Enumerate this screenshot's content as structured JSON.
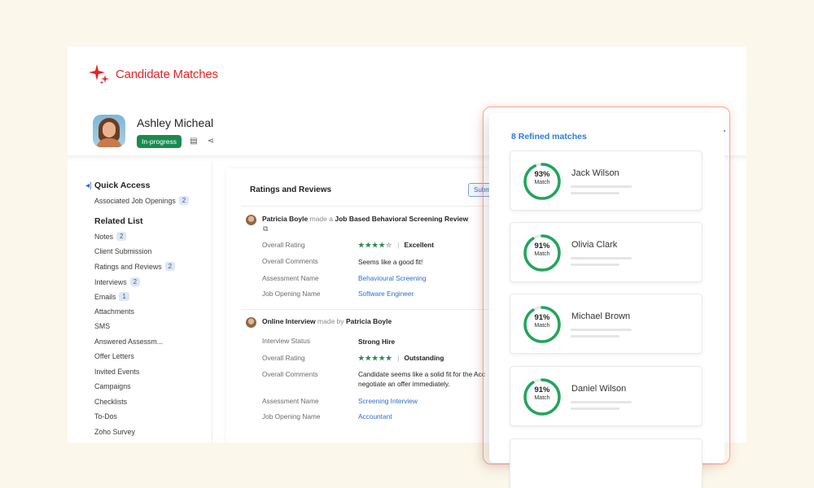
{
  "brand": {
    "title": "Candidate Matches",
    "color": "#e42527"
  },
  "profile": {
    "name": "Ashley Micheal",
    "status": "In-progress",
    "status_color": "#1a8a4f",
    "icons": [
      "notes-icon",
      "share-icon"
    ]
  },
  "sidebar": {
    "quick_access": {
      "heading": "Quick Access",
      "items": [
        {
          "label": "Associated Job Openings",
          "count": "2"
        }
      ]
    },
    "related_list": {
      "heading": "Related List",
      "items": [
        {
          "label": "Notes",
          "count": "2"
        },
        {
          "label": "Client Submission",
          "count": ""
        },
        {
          "label": "Ratings and Reviews",
          "count": "2"
        },
        {
          "label": "Interviews",
          "count": "2"
        },
        {
          "label": "Emails",
          "count": "1"
        },
        {
          "label": "Attachments",
          "count": ""
        },
        {
          "label": "SMS",
          "count": ""
        },
        {
          "label": "Answered Assessm...",
          "count": ""
        },
        {
          "label": "Offer Letters",
          "count": ""
        },
        {
          "label": "Invited Events",
          "count": ""
        },
        {
          "label": "Campaigns",
          "count": ""
        },
        {
          "label": "Checklists",
          "count": ""
        },
        {
          "label": "To-Dos",
          "count": ""
        },
        {
          "label": "Zoho Survey",
          "count": ""
        }
      ]
    }
  },
  "reviews": {
    "title": "Ratings and Reviews",
    "submit_label": "Subm",
    "entries": [
      {
        "author": "Patricia Boyle",
        "connector": "made a",
        "subject": "Job Based Behavioral Screening Review",
        "fields": [
          {
            "label": "Overall Rating",
            "stars": 4,
            "value": "Excellent"
          },
          {
            "label": "Overall Comments",
            "value": "Seems like a good fit!"
          },
          {
            "label": "Assessment Name",
            "value": "Behavioural Screening"
          },
          {
            "label": "Job Opening Name",
            "value": "Software Engineer"
          }
        ]
      },
      {
        "author": "Patricia Boyle",
        "connector": "made by",
        "subject": "Online Interview",
        "fields": [
          {
            "label": "Interview Status",
            "value": "Strong Hire"
          },
          {
            "label": "Overall Rating",
            "stars": 5,
            "value": "Outstanding"
          },
          {
            "label": "Overall Comments",
            "value": "Candidate seems like a solid fit for the Acc",
            "value2": "negotiate an offer immediately."
          },
          {
            "label": "Assessment Name",
            "value": "Screening Interview"
          },
          {
            "label": "Job Opening Name",
            "value": "Accountant"
          }
        ]
      }
    ]
  },
  "matches": {
    "title": "8 Refined matches",
    "items": [
      {
        "name": "Jack Wilson",
        "percent": "93%",
        "match_label": "Match",
        "fraction": 0.93
      },
      {
        "name": "Olivia Clark",
        "percent": "91%",
        "match_label": "Match",
        "fraction": 0.91
      },
      {
        "name": "Michael Brown",
        "percent": "91%",
        "match_label": "Match",
        "fraction": 0.91
      },
      {
        "name": "Daniel Wilson",
        "percent": "91%",
        "match_label": "Match",
        "fraction": 0.91
      }
    ],
    "ring_color": "#22a55a"
  }
}
